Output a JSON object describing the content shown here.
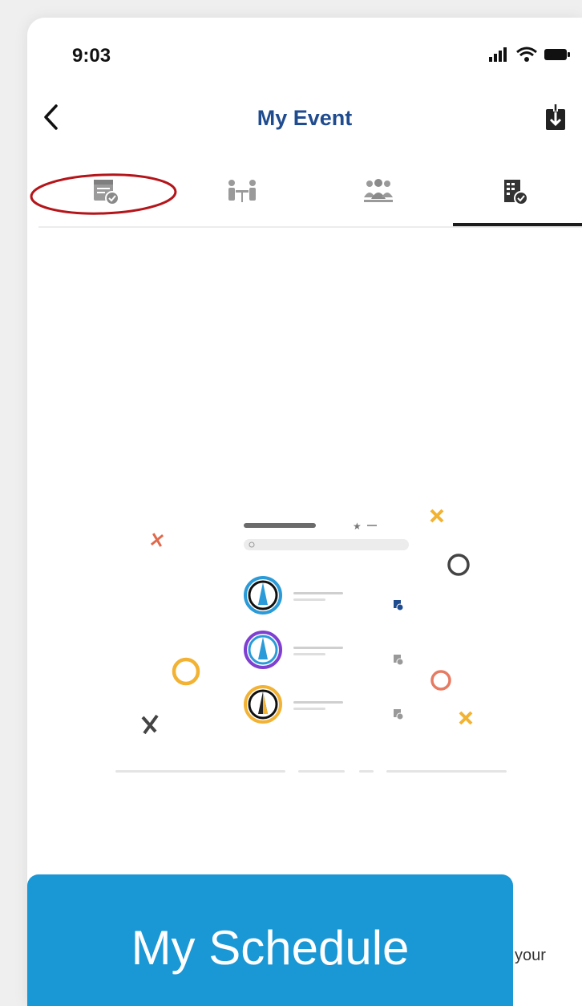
{
  "status_bar": {
    "time": "9:03"
  },
  "nav": {
    "title": "My Event"
  },
  "tabs": [
    {
      "name": "schedule",
      "icon": "calendar-check-icon",
      "active": false
    },
    {
      "name": "meetings",
      "icon": "meeting-table-icon",
      "active": false
    },
    {
      "name": "attendees",
      "icon": "group-icon",
      "active": false
    },
    {
      "name": "exhibitors",
      "icon": "building-check-icon",
      "active": true
    }
  ],
  "caption": {
    "label": "My Schedule"
  },
  "body_fragment": "your",
  "colors": {
    "title": "#1f4b8f",
    "banner": "#1a97d5",
    "annotation": "#b4151a",
    "tab_icon": "#8e8e8e",
    "tab_icon_active": "#333333"
  }
}
